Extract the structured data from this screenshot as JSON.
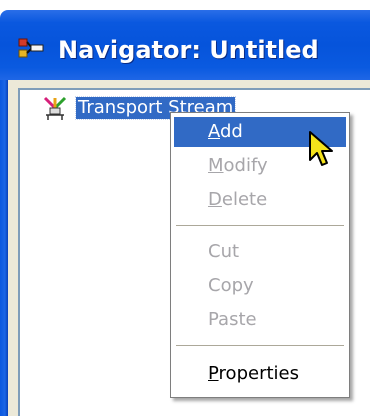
{
  "window": {
    "title": "Navigator: Untitled",
    "title_icon": "navigator-icon"
  },
  "tree": {
    "items": [
      {
        "label": "Transport Stream",
        "icon": "transport-stream-icon",
        "selected": true
      }
    ]
  },
  "context_menu": {
    "items": [
      {
        "label_ul": "A",
        "label_rest": "dd",
        "enabled": true,
        "highlighted": true
      },
      {
        "label_ul": "M",
        "label_rest": "odify",
        "enabled": false
      },
      {
        "label_ul": "D",
        "label_rest": "elete",
        "enabled": false
      },
      {
        "label": "Cut",
        "enabled": false
      },
      {
        "label": "Copy",
        "enabled": false
      },
      {
        "label": "Paste",
        "enabled": false
      },
      {
        "label_ul": "P",
        "label_rest": "roperties",
        "enabled": true
      }
    ]
  },
  "colors": {
    "titlebar": "#0654db",
    "selection": "#316ac5",
    "disabled_text": "#a7a6aa"
  },
  "cursor": {
    "icon": "arrow-cursor-icon"
  }
}
